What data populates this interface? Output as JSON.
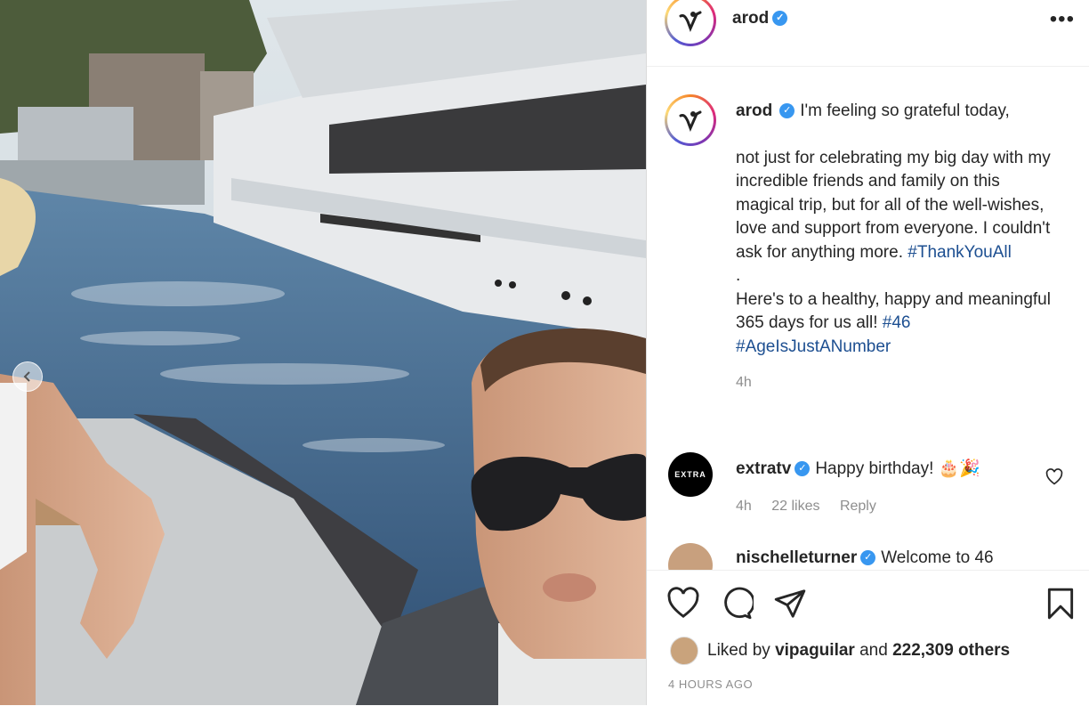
{
  "post": {
    "username": "arod",
    "more_label": "•••",
    "caption": {
      "first_line": "I'm feeling so grateful today,",
      "body": "not just for celebrating my big day with my incredible friends and family on this magical trip, but for all of the well-wishes, love and support from everyone. I couldn't ask for anything more.",
      "tag1": "#ThankYouAll",
      "dot": ".",
      "second": "Here's to a healthy, happy and meaningful 365 days for us all!",
      "tag2": "#46",
      "tag3": "#AgeIsJustANumber",
      "time": "4h"
    },
    "comments": [
      {
        "username": "extratv",
        "avatar_text": "EXTRA",
        "text": "Happy birthday! 🎂🎉",
        "time": "4h",
        "likes": "22 likes",
        "reply": "Reply"
      },
      {
        "username": "nischelleturner",
        "text": "Welcome to 46"
      }
    ],
    "likes": {
      "prefix": "Liked by",
      "user": "vipaguilar",
      "and": "and",
      "count": "222,309 others"
    },
    "timestamp": "4 HOURS AGO"
  },
  "icons": [
    "arod-logo-icon",
    "verified-icon",
    "heart-icon",
    "comment-icon",
    "share-icon",
    "bookmark-icon",
    "chevron-left-icon"
  ],
  "colors": {
    "accent": "#3897f0",
    "hashtag": "#1d4f91",
    "muted": "#8e8e8e"
  }
}
